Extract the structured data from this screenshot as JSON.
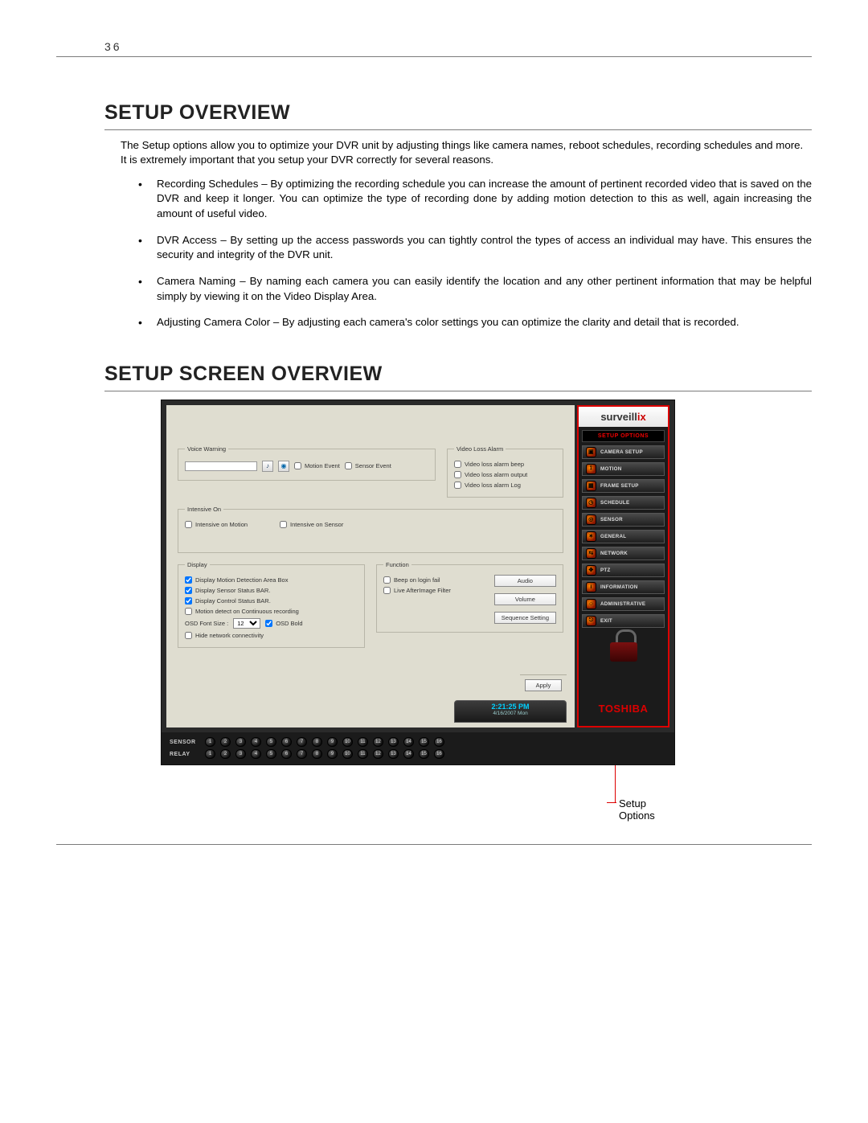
{
  "page_number": "36",
  "heading1": "SETUP OVERVIEW",
  "intro": "The Setup options allow you to optimize your DVR unit by adjusting things like camera names, reboot schedules, recording schedules and more. It is extremely important that you setup your DVR correctly for several reasons.",
  "bullets": [
    "Recording Schedules – By optimizing the recording schedule you can increase the amount of pertinent recorded video that is saved on the DVR and keep it longer. You can optimize the type of recording done by adding motion detection to this as well, again increasing the amount of useful video.",
    "DVR Access – By setting up the access passwords you can tightly control the types of access an individual may have. This ensures the security and integrity of the DVR unit.",
    "Camera Naming – By naming each camera you can easily identify the location and any other pertinent information that may be helpful simply by viewing it on the Video Display Area.",
    "Adjusting Camera Color – By adjusting each camera's color settings you can optimize the clarity and detail that is recorded."
  ],
  "heading2": "SETUP SCREEN OVERVIEW",
  "brand": "surveill",
  "panel": {
    "voice_warning": {
      "legend": "Voice Warning",
      "motion_event": "Motion Event",
      "sensor_event": "Sensor Event"
    },
    "video_loss": {
      "legend": "Video Loss Alarm",
      "beep": "Video loss alarm beep",
      "output": "Video loss alarm output",
      "log": "Video loss alarm Log"
    },
    "intensive": {
      "legend": "Intensive On",
      "motion": "Intensive on Motion",
      "sensor": "Intensive on Sensor"
    },
    "display": {
      "legend": "Display",
      "motion_box": "Display Motion Detection Area Box",
      "sensor_bar": "Display Sensor Status BAR.",
      "control_bar": "Display Control Status BAR.",
      "motion_cont": "Motion detect on Continuous recording",
      "osd_label": "OSD Font Size :",
      "osd_value": "12",
      "osd_bold": "OSD Bold",
      "hide_net": "Hide network connectivity"
    },
    "function": {
      "legend": "Function",
      "beep_login": "Beep on login fail",
      "afterimage": "Live AfterImage Filter",
      "audio_btn": "Audio",
      "volume_btn": "Volume",
      "seq_btn": "Sequence Setting"
    },
    "apply_btn": "Apply",
    "time": "2:21:25 PM",
    "date": "4/16/2007 Mon"
  },
  "sidebar": {
    "title": "SETUP OPTIONS",
    "items": [
      "CAMERA SETUP",
      "MOTION",
      "FRAME SETUP",
      "SCHEDULE",
      "SENSOR",
      "GENERAL",
      "NETWORK",
      "PTZ",
      "INFORMATION",
      "ADMINISTRATIVE",
      "EXIT"
    ]
  },
  "toshiba": "TOSHIBA",
  "sensor_label": "SENSOR",
  "relay_label": "RELAY",
  "numbers": [
    "1",
    "2",
    "3",
    "4",
    "5",
    "6",
    "7",
    "8",
    "9",
    "10",
    "11",
    "12",
    "13",
    "14",
    "15",
    "16"
  ],
  "callout": "Setup Options"
}
